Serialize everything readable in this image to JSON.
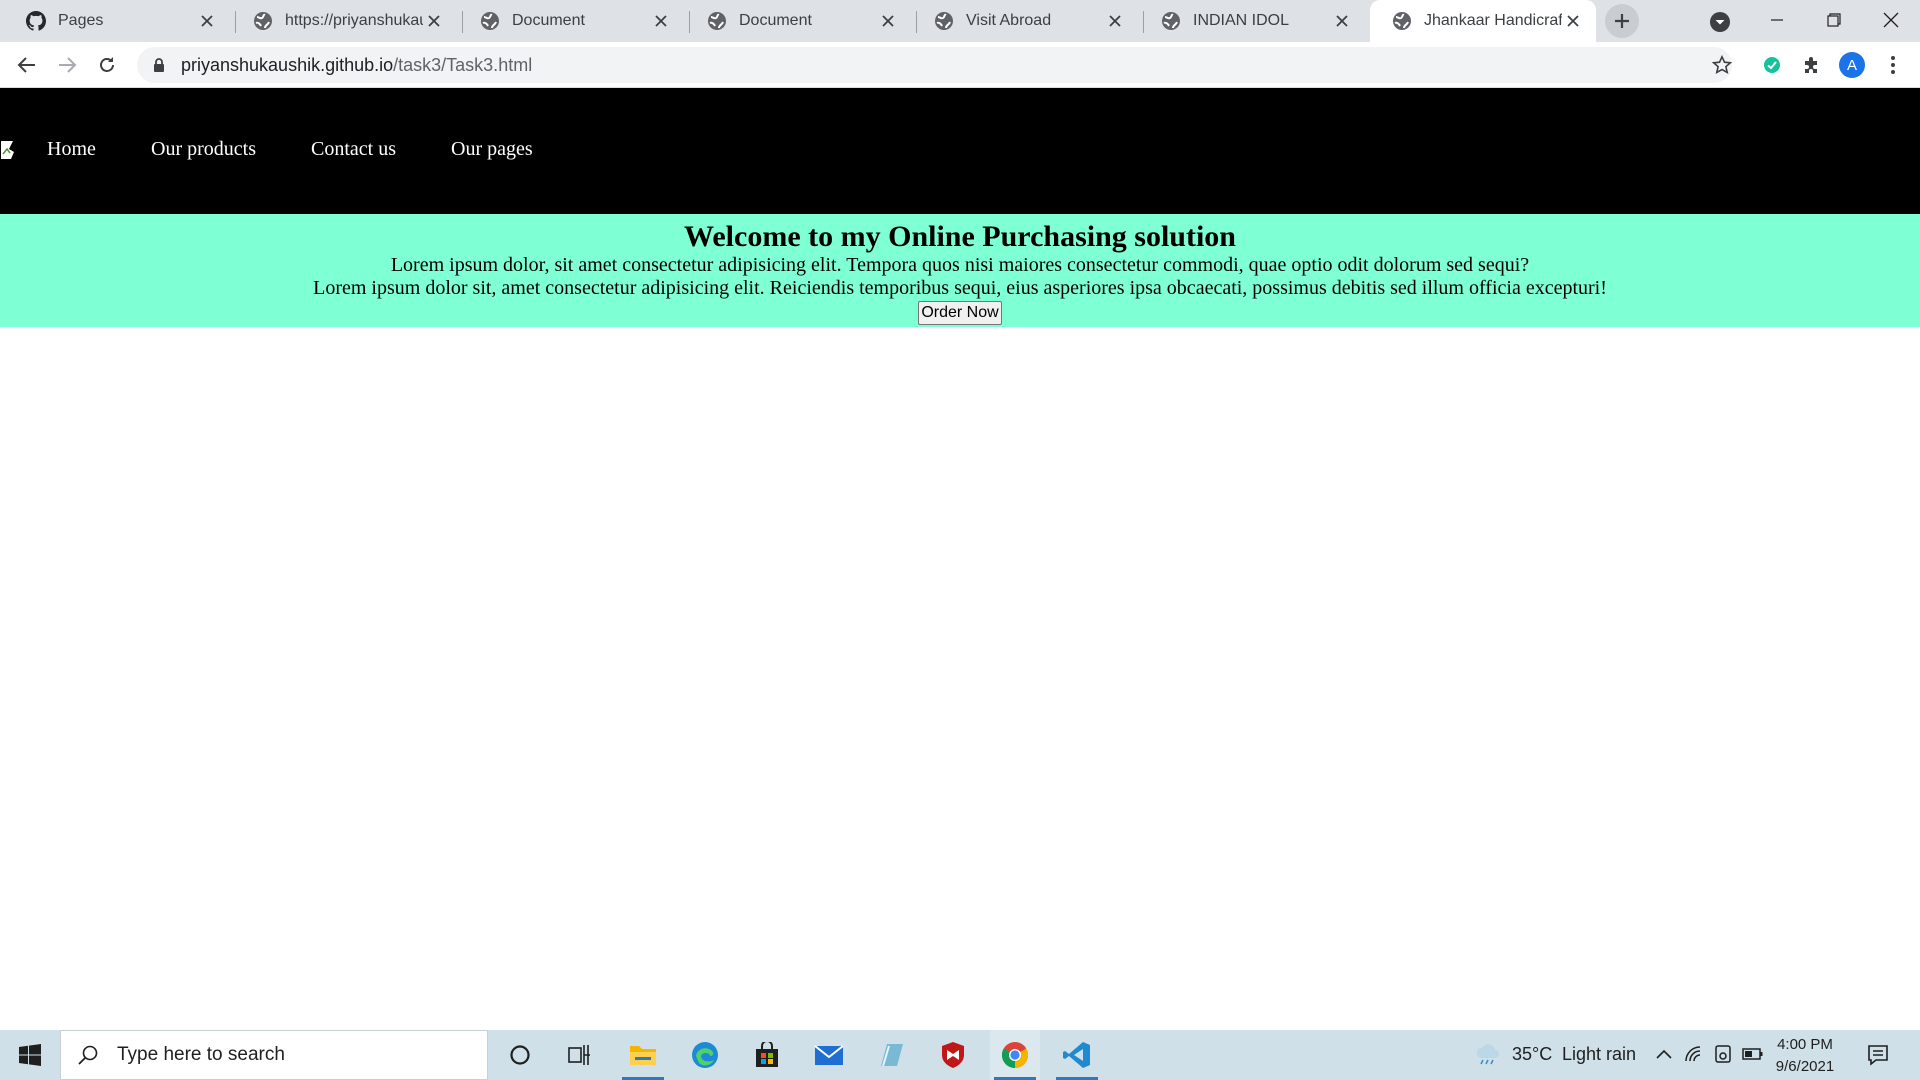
{
  "browser": {
    "tabs": [
      {
        "title": "Pages",
        "favicon": "github-icon",
        "active": false
      },
      {
        "title": "https://priyanshukaushik.github.io",
        "favicon": "globe-icon",
        "active": false
      },
      {
        "title": "Document",
        "favicon": "globe-icon",
        "active": false
      },
      {
        "title": "Document",
        "favicon": "globe-icon",
        "active": false
      },
      {
        "title": "Visit Abroad",
        "favicon": "globe-icon",
        "active": false
      },
      {
        "title": "INDIAN IDOL",
        "favicon": "globe-icon",
        "active": false
      },
      {
        "title": "Jhankaar Handicrafts",
        "favicon": "globe-icon",
        "active": true
      }
    ],
    "url_host": "priyanshukaushik.github.io",
    "url_path": "/task3/Task3.html",
    "profile_initial": "A"
  },
  "page": {
    "nav": {
      "links": [
        "Home",
        "Our products",
        "Contact us",
        "Our pages"
      ]
    },
    "hero": {
      "heading": "Welcome to my Online Purchasing solution",
      "line1": "Lorem ipsum dolor, sit amet consectetur adipisicing elit. Tempora quos nisi maiores consectetur commodi, quae optio odit dolorum sed sequi?",
      "line2": "Lorem ipsum dolor sit, amet consectetur adipisicing elit. Reiciendis temporibus sequi, eius asperiores ipsa obcaecati, possimus debitis sed illum officia excepturi!",
      "button_label": "Order Now",
      "background": "#7fffd4"
    }
  },
  "taskbar": {
    "search_placeholder": "Type here to search",
    "weather_temp": "35°C",
    "weather_desc": "Light rain",
    "time": "4:00 PM",
    "date": "9/6/2021"
  }
}
